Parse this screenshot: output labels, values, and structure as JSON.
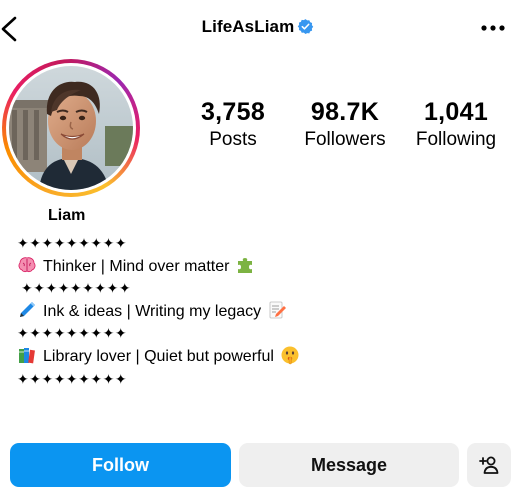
{
  "header": {
    "username": "LifeAsLiam",
    "icons": {
      "back": "chevron-left-icon",
      "verified": "verified-badge-icon",
      "more": "more-horizontal-icon"
    },
    "verified_color": "#3897f0"
  },
  "profile": {
    "avatar": "profile-photo",
    "ring_colors": [
      "#f9a825",
      "#e91e63",
      "#9c27b0"
    ],
    "stats": [
      {
        "value": "3,758",
        "label": "Posts"
      },
      {
        "value": "98.7K",
        "label": "Followers"
      },
      {
        "value": "1,041",
        "label": "Following"
      }
    ],
    "name": "Liam"
  },
  "bio": {
    "divider": "✦✦✦✦✦✦✦✦✦",
    "lines": [
      {
        "icon": "brain-emoji",
        "text": "Thinker | Mind over matter",
        "end_icon": "puzzle-piece-emoji"
      },
      {
        "icon": "pen-emoji",
        "text": "Ink & ideas | Writing my legacy",
        "end_icon": "memo-emoji"
      },
      {
        "icon": "books-emoji",
        "text": "Library lover | Quiet but powerful",
        "end_icon": "shushing-face-emoji"
      }
    ]
  },
  "actions": {
    "follow_label": "Follow",
    "message_label": "Message",
    "suggest_icon": "add-person-icon",
    "follow_color": "#0b95f1",
    "secondary_color": "#efefef"
  }
}
